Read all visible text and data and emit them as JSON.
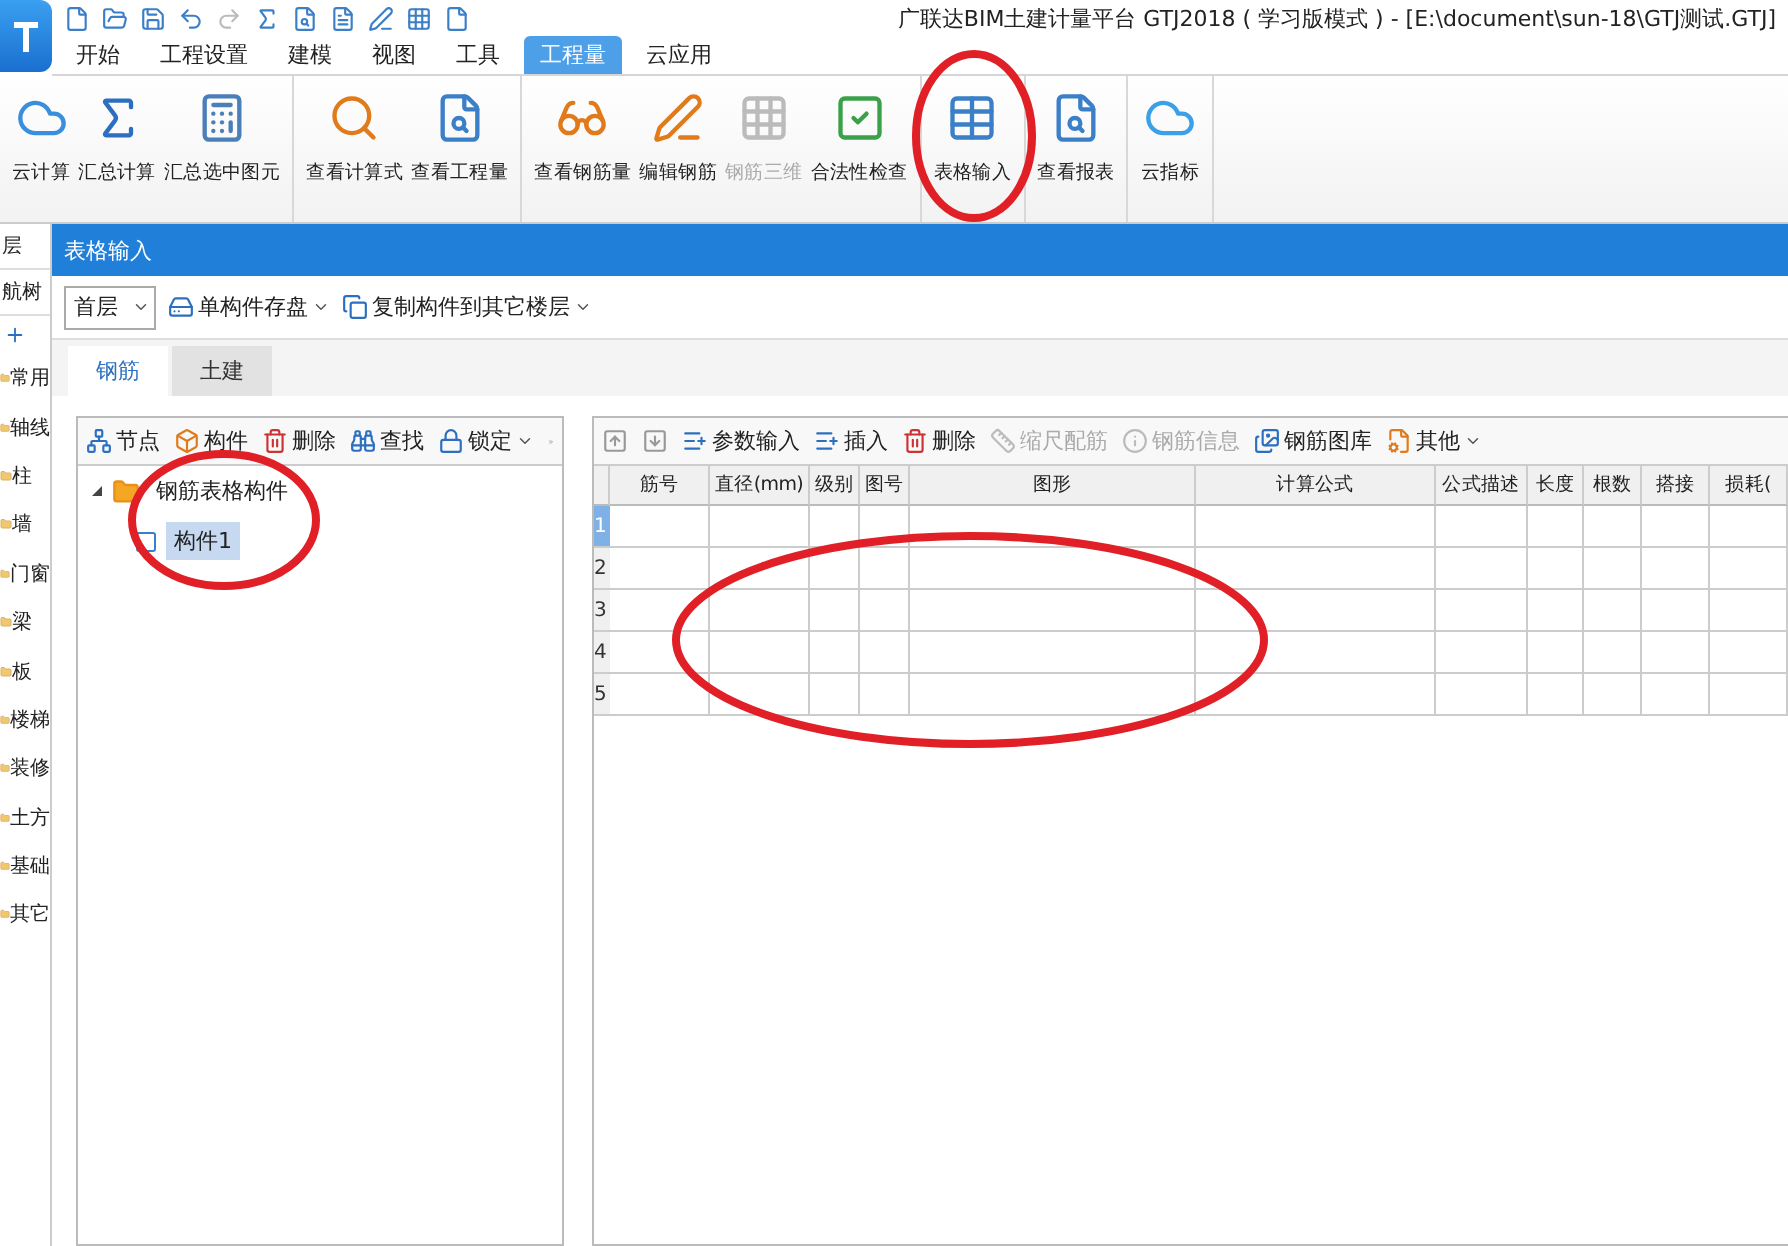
{
  "window": {
    "title": "广联达BIM土建计量平台 GTJ2018 ( 学习版模式 ) - [E:\\document\\sun-18\\GTJ测试.GTJ]"
  },
  "menu_tabs": [
    {
      "label": "开始",
      "selected": false
    },
    {
      "label": "工程设置",
      "selected": false
    },
    {
      "label": "建模",
      "selected": false
    },
    {
      "label": "视图",
      "selected": false
    },
    {
      "label": "工具",
      "selected": false
    },
    {
      "label": "工程量",
      "selected": true
    },
    {
      "label": "云应用",
      "selected": false
    }
  ],
  "ribbon": {
    "groups": [
      {
        "buttons": [
          {
            "label": "云计算",
            "disabled": false
          },
          {
            "label": "汇总计算",
            "disabled": false
          },
          {
            "label": "汇总选中图元",
            "disabled": false
          }
        ]
      },
      {
        "buttons": [
          {
            "label": "查看计算式",
            "disabled": false
          },
          {
            "label": "查看工程量",
            "disabled": false
          }
        ]
      },
      {
        "buttons": [
          {
            "label": "查看钢筋量",
            "disabled": false
          },
          {
            "label": "编辑钢筋",
            "disabled": false
          },
          {
            "label": "钢筋三维",
            "disabled": true
          },
          {
            "label": "合法性检查",
            "disabled": false
          }
        ]
      },
      {
        "buttons": [
          {
            "label": "表格输入",
            "disabled": false
          }
        ]
      },
      {
        "buttons": [
          {
            "label": "查看报表",
            "disabled": false
          }
        ]
      },
      {
        "buttons": [
          {
            "label": "云指标",
            "disabled": false
          }
        ]
      }
    ]
  },
  "nav_panel": {
    "floor": "层",
    "title": "航树",
    "items": [
      "常用",
      "轴线",
      "柱",
      "墙",
      "门窗",
      "梁",
      "板",
      "楼梯",
      "装修",
      "土方",
      "基础",
      "其它"
    ]
  },
  "dialog": {
    "title": "表格输入",
    "floor": "首层",
    "toolbar": [
      {
        "label": "单构件存盘",
        "has_menu": true
      },
      {
        "label": "复制构件到其它楼层",
        "has_menu": true
      }
    ],
    "tabs": [
      {
        "label": "钢筋",
        "selected": true
      },
      {
        "label": "土建",
        "selected": false
      }
    ],
    "tree_toolbar": [
      {
        "label": "节点",
        "has_menu": false
      },
      {
        "label": "构件",
        "has_menu": false
      },
      {
        "label": "删除",
        "has_menu": false
      },
      {
        "label": "查找",
        "has_menu": false
      },
      {
        "label": "锁定",
        "has_menu": true
      }
    ],
    "tree": [
      {
        "label": "钢筋表格构件",
        "expanded": true,
        "selected": false,
        "children": [
          {
            "label": "构件1",
            "selected": true
          }
        ]
      }
    ],
    "grid_toolbar": [
      {
        "label": "参数输入",
        "disabled": false,
        "has_menu": false
      },
      {
        "label": "插入",
        "disabled": false,
        "has_menu": false
      },
      {
        "label": "删除",
        "disabled": false,
        "has_menu": false
      },
      {
        "label": "缩尺配筋",
        "disabled": true,
        "has_menu": false
      },
      {
        "label": "钢筋信息",
        "disabled": true,
        "has_menu": false
      },
      {
        "label": "钢筋图库",
        "disabled": false,
        "has_menu": false
      },
      {
        "label": "其他",
        "disabled": false,
        "has_menu": true
      }
    ],
    "table": {
      "columns": [
        "筋号",
        "直径(mm)",
        "级别",
        "图号",
        "图形",
        "计算公式",
        "公式描述",
        "长度",
        "根数",
        "搭接",
        "损耗("
      ],
      "rows": [
        {
          "number": "1",
          "selected": true
        },
        {
          "number": "2",
          "selected": false
        },
        {
          "number": "3",
          "selected": false
        },
        {
          "number": "4",
          "selected": false
        },
        {
          "number": "5",
          "selected": false
        }
      ]
    }
  }
}
